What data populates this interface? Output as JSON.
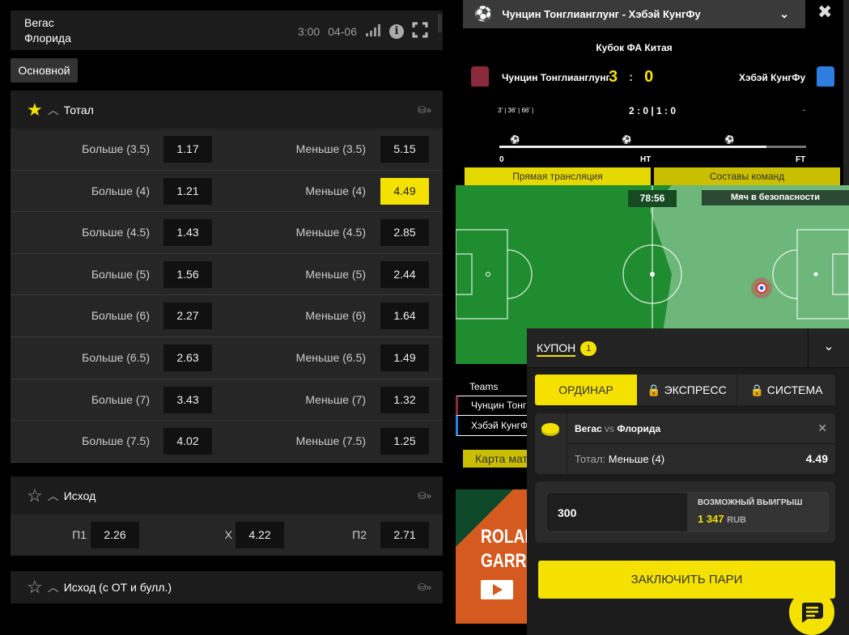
{
  "event": {
    "team1": "Вегас",
    "team2": "Флорида",
    "time": "3:00",
    "date": "04-06",
    "icons": [
      "stats-icon",
      "info-icon",
      "fullscreen-icon"
    ]
  },
  "tabs": [
    {
      "label": "Основной",
      "active": true
    }
  ],
  "total": {
    "title": "Тотал",
    "favorite": true,
    "rows": [
      {
        "over": "Больше (3.5)",
        "over_odd": "1.17",
        "under": "Меньше (3.5)",
        "under_odd": "5.15"
      },
      {
        "over": "Больше (4)",
        "over_odd": "1.21",
        "under": "Меньше (4)",
        "under_odd": "4.49",
        "selected": "under"
      },
      {
        "over": "Больше (4.5)",
        "over_odd": "1.43",
        "under": "Меньше (4.5)",
        "under_odd": "2.85"
      },
      {
        "over": "Больше (5)",
        "over_odd": "1.56",
        "under": "Меньше (5)",
        "under_odd": "2.44"
      },
      {
        "over": "Больше (6)",
        "over_odd": "2.27",
        "under": "Меньше (6)",
        "under_odd": "1.64"
      },
      {
        "over": "Больше (6.5)",
        "over_odd": "2.63",
        "under": "Меньше (6.5)",
        "under_odd": "1.49"
      },
      {
        "over": "Больше (7)",
        "over_odd": "3.43",
        "under": "Меньше (7)",
        "under_odd": "1.32"
      },
      {
        "over": "Больше (7.5)",
        "over_odd": "4.02",
        "under": "Меньше (7.5)",
        "under_odd": "1.25"
      }
    ]
  },
  "outcome": {
    "title": "Исход",
    "p1": "П1",
    "p1_odd": "2.26",
    "x": "Х",
    "x_odd": "4.22",
    "p2": "П2",
    "p2_odd": "2.71"
  },
  "outcome_ot": {
    "title": "Исход (с ОТ и булл.)"
  },
  "live": {
    "match": "Чунцин Тонглианглунг - Хэбэй КунгФу",
    "league": "Кубок ФА Китая",
    "home": "Чунцин Тонглианглунг",
    "away": "Хэбэй КунгФу",
    "score_home": "3",
    "score_sep": ":",
    "score_away": "0",
    "goals": "3' | 36' | 66' |",
    "halves": "2 : 0 | 1 : 0",
    "away_goals": "-",
    "tl_start": "0",
    "tl_ht": "HT",
    "tl_ft": "FT",
    "progress": 0.87,
    "tab_stream": "Прямая трансляция",
    "tab_lineups": "Составы команд",
    "clock": "78:56",
    "status": "Мяч в безопасности",
    "teams_header": "Teams",
    "team_row1": "Чунцин Тонг",
    "team_row2": "Хэбэй КунгФ",
    "map_btn": "Карта мат",
    "banner": "ROLAND GARROS",
    "home_color": "#8b2a3c",
    "away_color": "#2e7de0"
  },
  "coupon": {
    "title": "КУПОН",
    "count": "1",
    "tabs": [
      "ОРДИНАР",
      "ЭКСПРЕСС",
      "СИСТЕМА"
    ],
    "bet": {
      "team1": "Вегас",
      "vs": "vs",
      "team2": "Флорида",
      "market": "Тотал:",
      "pick": "Меньше (4)",
      "odd": "4.49"
    },
    "stake": "300",
    "win_label": "ВОЗМОЖНЫЙ ВЫИГРЫШ",
    "win_value": "1 347",
    "currency": "RUB",
    "submit": "ЗАКЛЮЧИТЬ ПАРИ"
  },
  "colors": {
    "accent": "#f5e100",
    "bg": "#000000",
    "panel": "#1c1c1c"
  }
}
